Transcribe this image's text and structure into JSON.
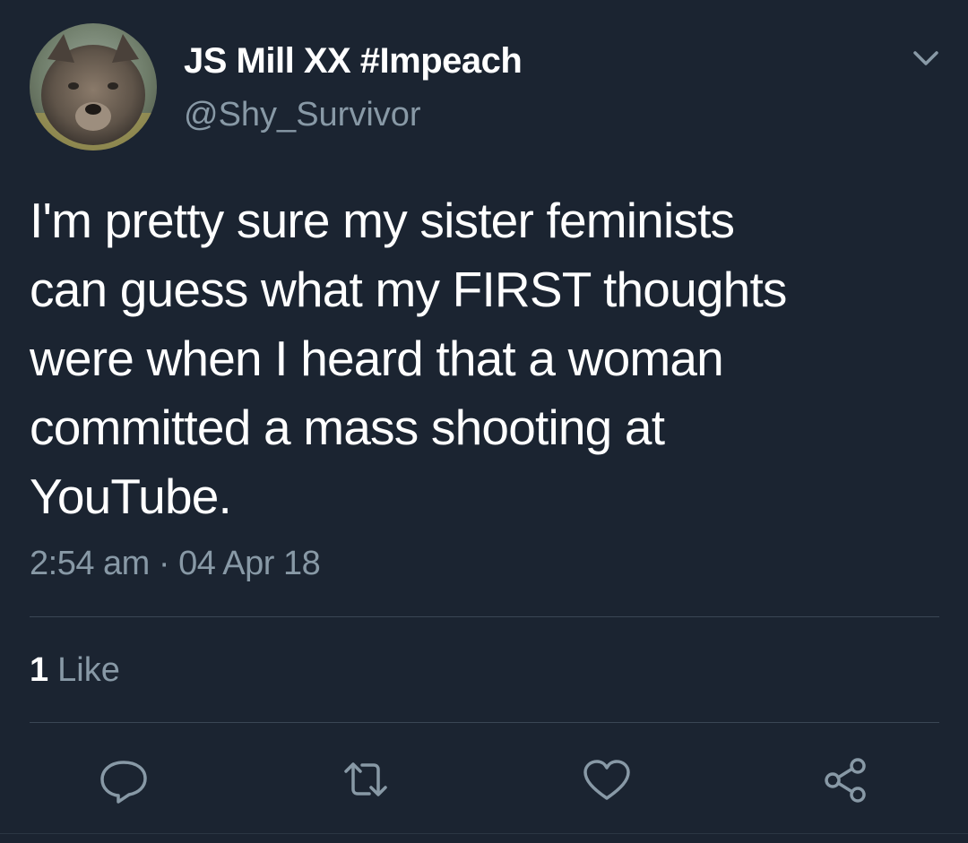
{
  "tweet": {
    "author": {
      "display_name": "JS Mill XX #Impeach",
      "handle": "@Shy_Survivor"
    },
    "text_lines": [
      "I'm pretty sure my sister feminists",
      "can guess what my FIRST thoughts",
      "were when I heard that a woman",
      "committed a mass shooting at",
      "YouTube."
    ],
    "timestamp": "2:54 am · 04 Apr 18",
    "likes": {
      "count": "1",
      "label": "Like"
    }
  },
  "actions": {
    "icons": [
      "reply-icon",
      "retweet-icon",
      "like-icon",
      "share-icon"
    ]
  },
  "colors": {
    "background": "#1b2431",
    "primary_text": "#ffffff",
    "secondary_text": "#8899a6",
    "divider": "#3a4654"
  }
}
